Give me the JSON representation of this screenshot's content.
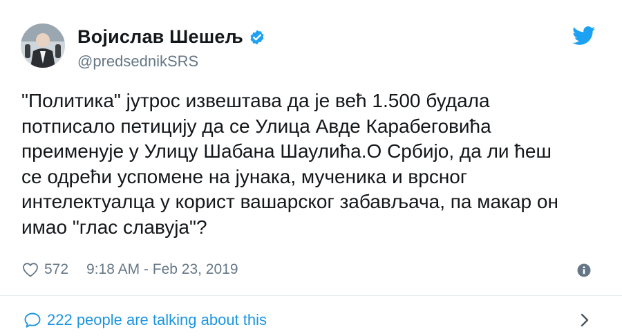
{
  "author": {
    "display_name": "Војислав Шешељ",
    "handle": "@predsednikSRS"
  },
  "tweet": {
    "text": "\"Политика\" јутрос извештава да је већ 1.500 будала\nпотписало петицију да се Улица Авде Карабеговића\nпреименује у Улицу Шабана Шаулића.О Србијо, да ли ћеш\nсе одрећи успомене на јунака, мученика и врсног\nинтелектуалца у корист вашарског забављача, па макар он\nимао \"глас славуја\"?",
    "likes": "572",
    "timestamp": "9:18 AM - Feb 23, 2019"
  },
  "footer": {
    "talking_text": "222 people are talking about this"
  },
  "icons": {
    "verified": "verified-badge-icon",
    "brand": "twitter-bird-icon",
    "like": "heart-icon",
    "info": "info-icon",
    "conversation": "speech-bubble-icon",
    "chevron": "chevron-right-icon"
  },
  "colors": {
    "brand_blue": "#1da1f2",
    "link_blue": "#1b95e0",
    "text": "#14171a",
    "muted": "#657786",
    "divider": "#e6ecf0"
  }
}
